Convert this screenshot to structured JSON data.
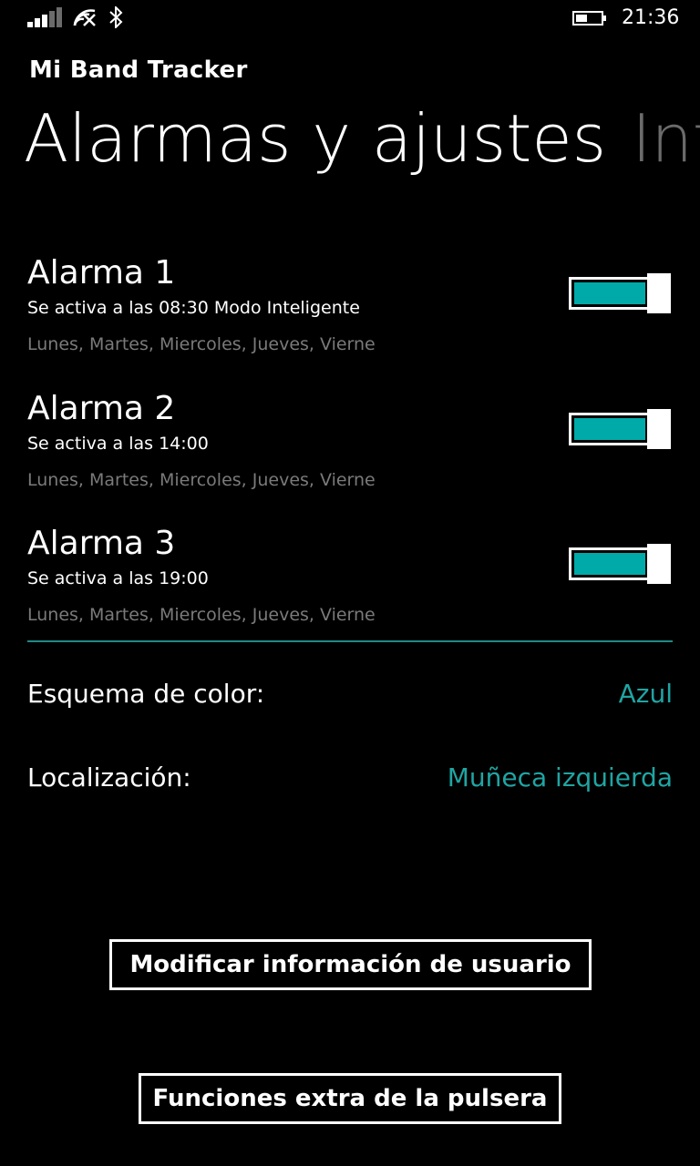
{
  "status": {
    "time": "21:36",
    "signal_icon": "signal-icon",
    "wifi_icon": "wifi-icon",
    "bluetooth_icon": "bluetooth-icon",
    "battery_icon": "battery-icon",
    "battery_level": 0.35
  },
  "app": {
    "title": "Mi Band Tracker"
  },
  "pivot": {
    "active": "Alarmas y ajustes",
    "next": "Inf"
  },
  "alarms": [
    {
      "name": "Alarma 1",
      "time": "Se activa a las 08:30 Modo Inteligente",
      "days": "Lunes, Martes, Miercoles, Jueves, Vierne",
      "enabled": true
    },
    {
      "name": "Alarma 2",
      "time": "Se activa a las 14:00",
      "days": "Lunes, Martes, Miercoles, Jueves, Vierne",
      "enabled": true
    },
    {
      "name": "Alarma 3",
      "time": "Se activa a las 19:00",
      "days": "Lunes, Martes, Miercoles, Jueves, Vierne",
      "enabled": true
    }
  ],
  "settings": {
    "color_label": "Esquema de color:",
    "color_value": "Azul",
    "location_label": "Localización:",
    "location_value": "Muñeca izquierda"
  },
  "buttons": {
    "edit_user": "Modificar información de usuario",
    "extra_functions": "Funciones extra de la pulsera"
  },
  "colors": {
    "accent": "#00aaa8",
    "accent_text": "#1fa5a3",
    "muted_text": "#7a7a7a"
  }
}
